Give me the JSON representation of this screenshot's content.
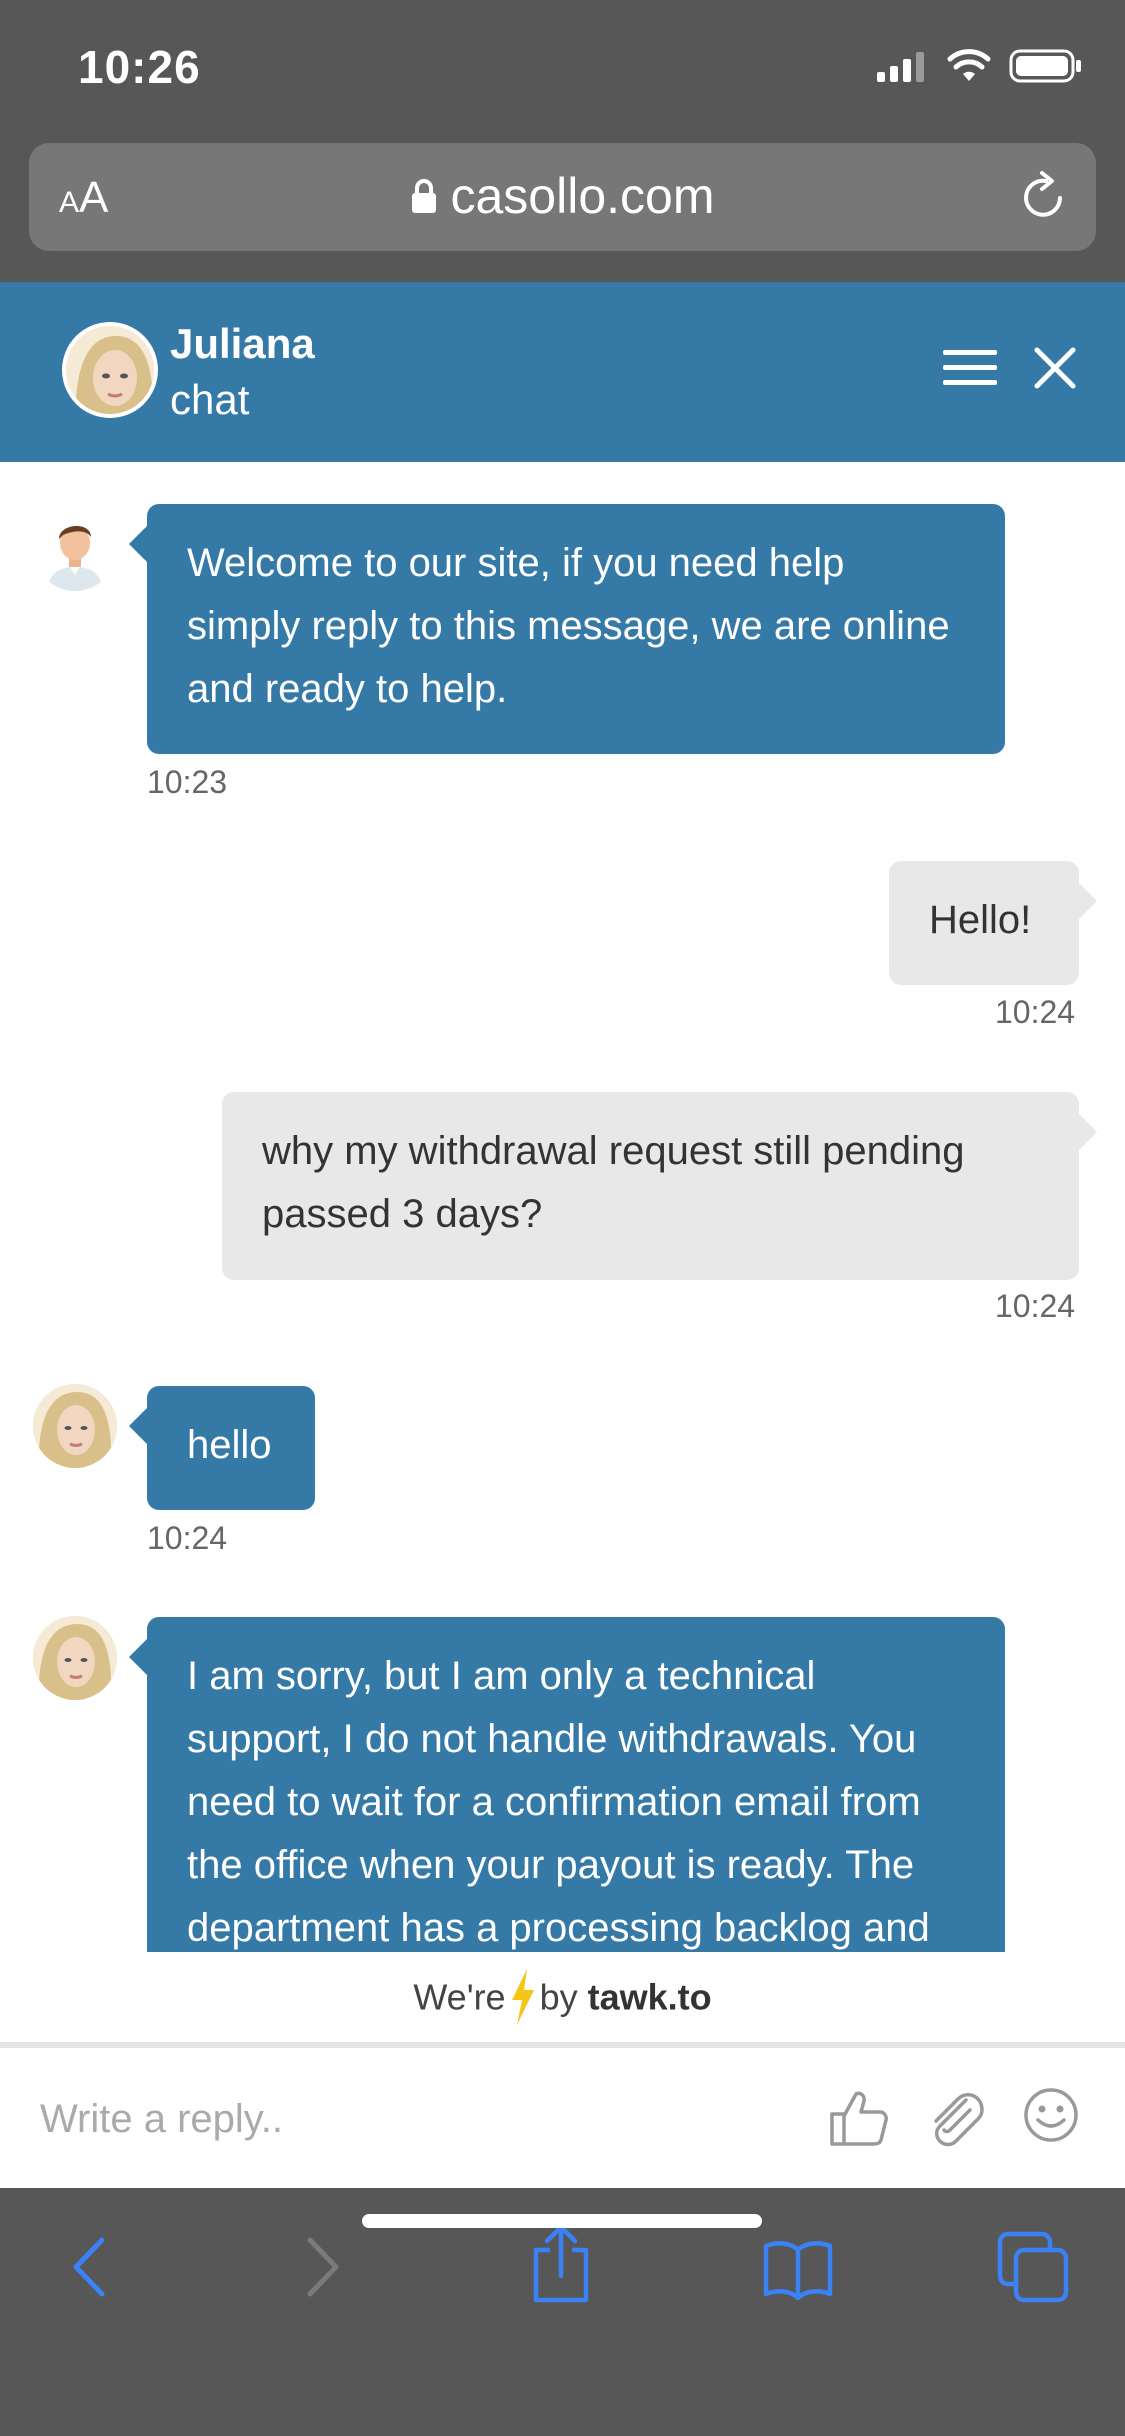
{
  "status_bar": {
    "time": "10:26"
  },
  "browser": {
    "aa_small": "A",
    "aa_large": "A",
    "url": "casollo.com"
  },
  "chat_header": {
    "agent_name": "Juliana",
    "subtitle": "chat"
  },
  "messages": [
    {
      "sender": "agent",
      "lines": [
        "Welcome to our site, if you need help",
        "simply reply to this message, we are online",
        "and ready to help."
      ],
      "time": "10:23"
    },
    {
      "sender": "visitor",
      "lines": [
        "Hello!"
      ],
      "time": "10:24"
    },
    {
      "sender": "visitor",
      "lines": [
        "why my withdrawal request still pending",
        "passed 3 days?"
      ],
      "time": "10:24"
    },
    {
      "sender": "agent",
      "lines": [
        "hello"
      ],
      "time": "10:24"
    },
    {
      "sender": "agent",
      "lines": [
        "I am sorry, but I am only a technical",
        "support, I do not handle withdrawals. You",
        "need to wait for a confirmation email from",
        "the office when your payout is ready. The",
        "department has a processing backlog and"
      ]
    }
  ],
  "powered_by": {
    "prefix": "We're",
    "middle": "by",
    "brand": "tawk.to"
  },
  "composer": {
    "placeholder": "Write a reply.."
  },
  "colors": {
    "accent": "#3579a6",
    "visitor_bubble": "#e8e8e8",
    "chrome": "#575757",
    "nav_blue": "#3b82f6"
  }
}
